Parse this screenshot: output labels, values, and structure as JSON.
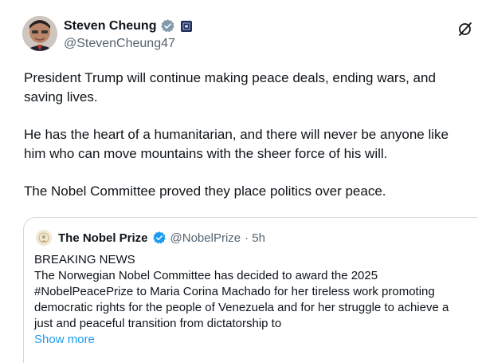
{
  "post": {
    "author": {
      "name": "Steven Cheung",
      "handle": "@StevenCheung47"
    },
    "paragraphs": [
      [
        "President Trump will continue making peace deals, ending wars, and",
        "saving lives."
      ],
      [
        "He has the heart of a humanitarian, and there will never be anyone like",
        "him who can move mountains with the sheer force of his will."
      ],
      [
        "The Nobel Committee proved they place politics over peace."
      ]
    ],
    "colors": {
      "verified_badge": "#829aab",
      "link": "#1d9bf0",
      "secondary_text": "#536471"
    }
  },
  "quote": {
    "author": {
      "name": "The Nobel Prize",
      "handle": "@NobelPrize",
      "time": "· 5h"
    },
    "lines": [
      "BREAKING NEWS",
      "The Norwegian Nobel Committee has decided to award the 2025",
      "#NobelPeacePrize to Maria Corina Machado for her tireless work promoting",
      "democratic rights for the people of Venezuela and for her struggle to achieve a",
      "just and peaceful transition from dictatorship to"
    ],
    "show_more": "Show more",
    "colors": {
      "verified_badge": "#1d9bf0"
    }
  }
}
